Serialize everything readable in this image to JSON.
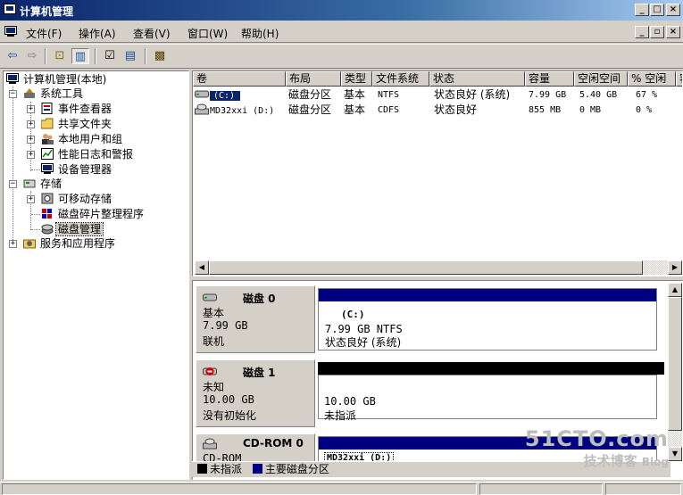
{
  "window": {
    "title": "计算机管理",
    "min": "_",
    "max": "□",
    "close": "×"
  },
  "menu": [
    "文件(F)",
    "操作(A)",
    "查看(V)",
    "窗口(W)",
    "帮助(H)"
  ],
  "mdi": {
    "min": "_",
    "restore": "▫",
    "close": "×"
  },
  "toolbar": {
    "back": "⇦",
    "forward": "⇨",
    "up": "⊡",
    "tree": "▥",
    "props": "☑",
    "pane": "▤",
    "help": "▩"
  },
  "tree": {
    "root": "计算机管理(本地)",
    "system_tools": "系统工具",
    "event_viewer": "事件查看器",
    "shared_folders": "共享文件夹",
    "local_users": "本地用户和组",
    "perf_logs": "性能日志和警报",
    "device_manager": "设备管理器",
    "storage": "存储",
    "removable": "可移动存储",
    "defrag": "磁盘碎片整理程序",
    "disk_mgmt": "磁盘管理",
    "services": "服务和应用程序",
    "expand_minus": "−",
    "expand_plus": "+"
  },
  "volume_list": {
    "columns": [
      "卷",
      "布局",
      "类型",
      "文件系统",
      "状态",
      "容量",
      "空闲空间",
      "% 空闲",
      "容"
    ],
    "rows": [
      {
        "name": "(C:)",
        "layout": "磁盘分区",
        "type": "基本",
        "fs": "NTFS",
        "status": "状态良好 (系统)",
        "capacity": "7.99 GB",
        "free": "5.40 GB",
        "pct": "67 %"
      },
      {
        "name": "MD32xxi  (D:)",
        "layout": "磁盘分区",
        "type": "基本",
        "fs": "CDFS",
        "status": "状态良好",
        "capacity": "855 MB",
        "free": "0 MB",
        "pct": "0 %"
      }
    ]
  },
  "scroll": {
    "left": "◀",
    "right": "▶",
    "up": "▲",
    "down": "▼"
  },
  "disks": [
    {
      "name": "磁盘 0",
      "type": "基本",
      "size": "7.99 GB",
      "state": "联机",
      "part_name": "(C:)",
      "part_size": "7.99 GB NTFS",
      "part_status": "状态良好 (系统)",
      "bar_color": "#000080"
    },
    {
      "name": "磁盘 1",
      "type": "未知",
      "size": "10.00 GB",
      "state": "没有初始化",
      "part_size": "10.00 GB",
      "part_status": "未指派",
      "bar_color": "#000000"
    },
    {
      "name": "CD-ROM 0",
      "type": "CD-ROM",
      "part_name": "MD32xxi  (D:)",
      "bar_color": "#000080"
    }
  ],
  "legend": {
    "unallocated": "未指派",
    "primary": "主要磁盘分区",
    "unallocated_color": "#000000",
    "primary_color": "#000080"
  },
  "watermark": {
    "line1": "51CTO.com",
    "line2_a": "技术博客",
    "line2_b": "Blog"
  }
}
